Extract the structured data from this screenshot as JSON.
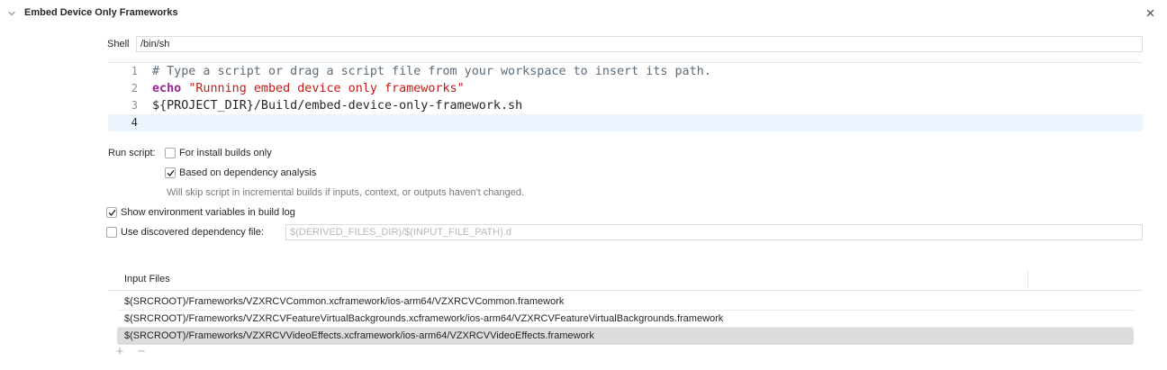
{
  "phase": {
    "title": "Embed Device Only Frameworks"
  },
  "shell": {
    "label": "Shell",
    "value": "/bin/sh"
  },
  "script": {
    "lines": [
      {
        "number": "1",
        "comment": "# Type a script or drag a script file from your workspace to insert its path."
      },
      {
        "number": "2",
        "keyword": "echo",
        "string": "\"Running embed device only frameworks\""
      },
      {
        "number": "3",
        "text": "${PROJECT_DIR}/Build/embed-device-only-framework.sh"
      },
      {
        "number": "4",
        "text": ""
      }
    ]
  },
  "run_script": {
    "label": "Run script:",
    "install_builds_only": {
      "label": "For install builds only",
      "checked": false
    },
    "dependency_analysis": {
      "label": "Based on dependency analysis",
      "checked": true
    },
    "hint": "Will skip script in incremental builds if inputs, context, or outputs haven't changed."
  },
  "show_env_vars": {
    "label": "Show environment variables in build log",
    "checked": true
  },
  "discovered_dep_file": {
    "label": "Use discovered dependency file:",
    "checked": false,
    "placeholder": "$(DERIVED_FILES_DIR)/$(INPUT_FILE_PATH).d"
  },
  "input_files": {
    "header": "Input Files",
    "rows": [
      "$(SRCROOT)/Frameworks/VZXRCVCommon.xcframework/ios-arm64/VZXRCVCommon.framework",
      "$(SRCROOT)/Frameworks/VZXRCVFeatureVirtualBackgrounds.xcframework/ios-arm64/VZXRCVFeatureVirtualBackgrounds.framework",
      "$(SRCROOT)/Frameworks/VZXRCVVideoEffects.xcframework/ios-arm64/VZXRCVVideoEffects.framework"
    ],
    "selected_index": 2,
    "add_label": "+",
    "remove_label": "−"
  },
  "icons": {
    "disclosure": "chevron-down-icon",
    "close": "close-icon",
    "checkmark": "checkmark-icon"
  }
}
